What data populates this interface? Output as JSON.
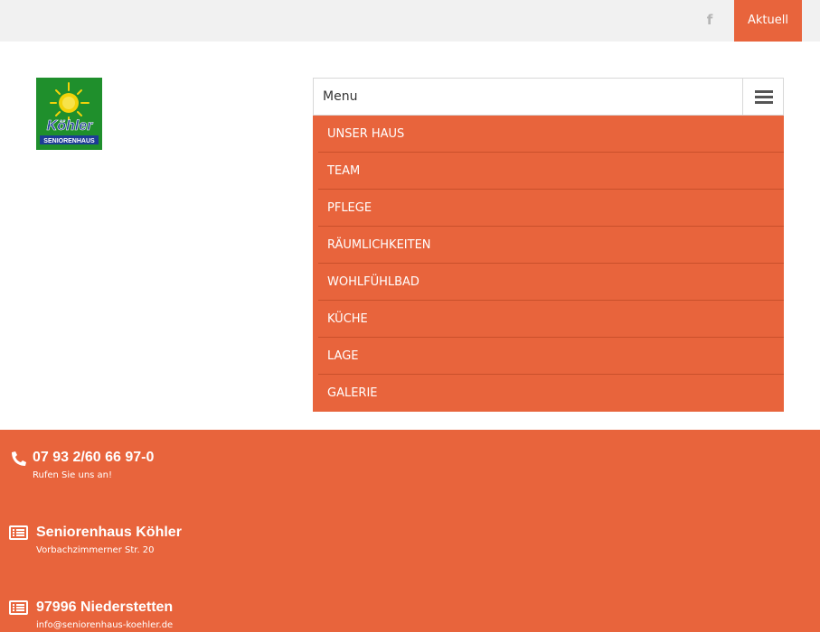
{
  "topbar": {
    "facebook_icon": "facebook-icon",
    "aktuell_label": "Aktuell"
  },
  "logo": {
    "brand": "Köhler",
    "tagline": "SENIORENHAUS"
  },
  "menu": {
    "label": "Menu",
    "toggle_icon": "hamburger-icon",
    "items": [
      {
        "label": "UNSER HAUS"
      },
      {
        "label": "TEAM"
      },
      {
        "label": "PFLEGE"
      },
      {
        "label": "RÄUMLICHKEITEN"
      },
      {
        "label": "WOHLFÜHLBAD"
      },
      {
        "label": "KÜCHE"
      },
      {
        "label": "LAGE"
      },
      {
        "label": "GALERIE"
      }
    ]
  },
  "footer": {
    "phone": {
      "icon": "phone-icon",
      "title": "07 93 2/60 66 97-0",
      "subtitle": "Rufen Sie uns an!"
    },
    "name": {
      "icon": "list-icon",
      "title": "Seniorenhaus Köhler",
      "subtitle": "Vorbachzimmerner Str. 20"
    },
    "city": {
      "icon": "list-icon",
      "title": "97996 Niederstetten",
      "subtitle": "info@seniorenhaus-koehler.de"
    }
  },
  "colors": {
    "accent": "#e8643c",
    "topbar": "#f1f1f1",
    "logo_green": "#1f8f2c",
    "logo_yellow": "#f2d20a",
    "logo_blue": "#1d3c96"
  }
}
